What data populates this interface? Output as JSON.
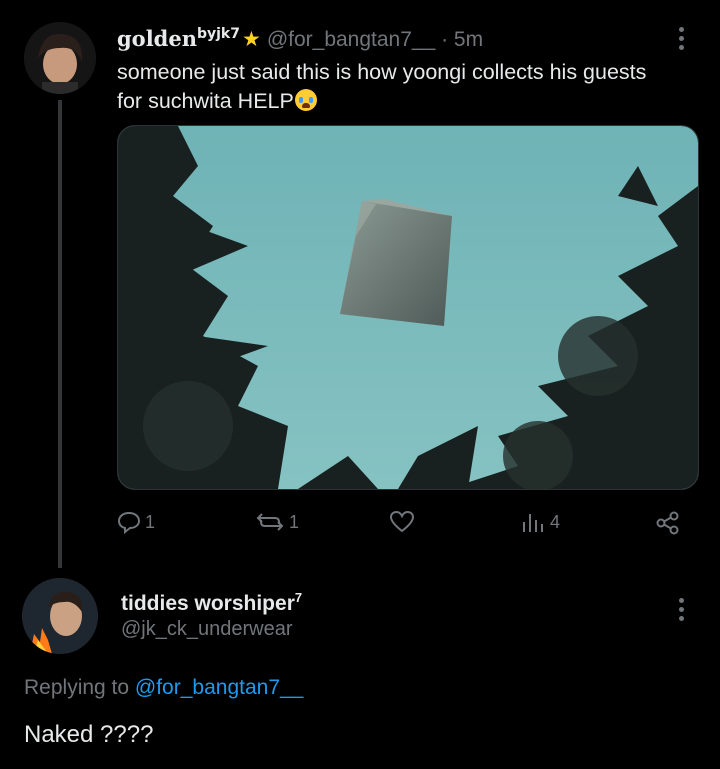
{
  "tweet": {
    "display_name": "golden",
    "name_sup": "byjk7",
    "star": "★",
    "handle": "@for_bangtan7__",
    "time": "· 5m",
    "text_line1": "someone just said this is how yoongi collects his guests",
    "text_line2": "for suchwita HELP",
    "emoji": "loudly-crying-face-icon",
    "media": "photo of a floating stone cube above pine trees",
    "counts": {
      "replies": "1",
      "reposts": "1",
      "likes": "",
      "views": "4"
    }
  },
  "reply": {
    "display_name": "tiddies worshiper",
    "name_sup": "7",
    "handle": "@jk_ck_underwear",
    "replying_prefix": "Replying to ",
    "replying_handle": "@for_bangtan7__",
    "text": "Naked ????"
  },
  "colors": {
    "background": "#000000",
    "text": "#e7e9ea",
    "muted": "#71767b",
    "link": "#1d9bf0"
  }
}
